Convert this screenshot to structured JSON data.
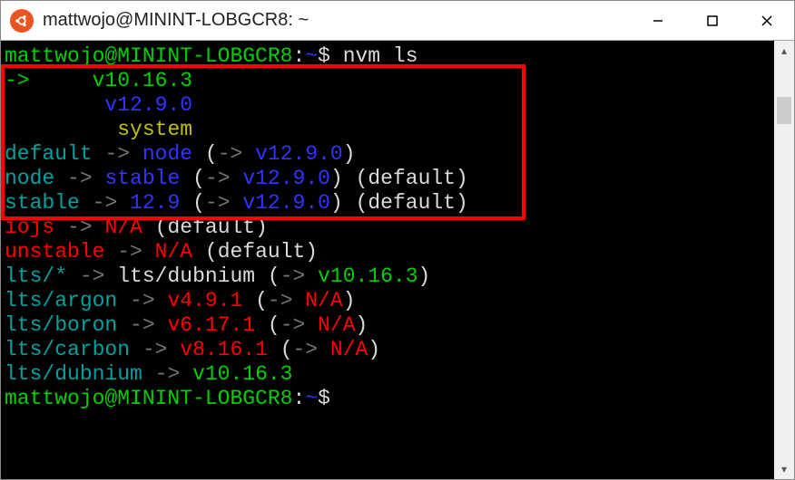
{
  "titlebar": {
    "title": "mattwojo@MININT-LOBGCR8: ~"
  },
  "prompt_line1": {
    "user_host": "mattwojo@MININT-LOBGCR8",
    "colon": ":",
    "path": "~",
    "dollar": "$",
    "command": " nvm ls"
  },
  "output": {
    "arrow": "->",
    "v1": "v10.16.3",
    "v2": "v12.9.0",
    "system": "system",
    "default_label": "default",
    "node_label": "node",
    "stable_label": "stable",
    "iojs_label": "iojs",
    "unstable_label": "unstable",
    "lts_star": "lts/*",
    "lts_dubnium": "lts/dubnium",
    "lts_argon": "lts/argon",
    "lts_boron": "lts/boron",
    "lts_carbon": "lts/carbon",
    "twelve_nine": "12.9",
    "v12_9_0": "v12.9.0",
    "na": "N/A",
    "v4": "v4.9.1",
    "v6": "v6.17.1",
    "v8": "v8.16.1",
    "v10": "v10.16.3",
    "arrow_gray": "->",
    "open": "(",
    "close": ")",
    "arrow_in": "->",
    "default_txt": "(default)"
  },
  "prompt_line2": {
    "user_host": "mattwojo@MININT-LOBGCR8",
    "colon": ":",
    "path": "~",
    "dollar": "$"
  }
}
